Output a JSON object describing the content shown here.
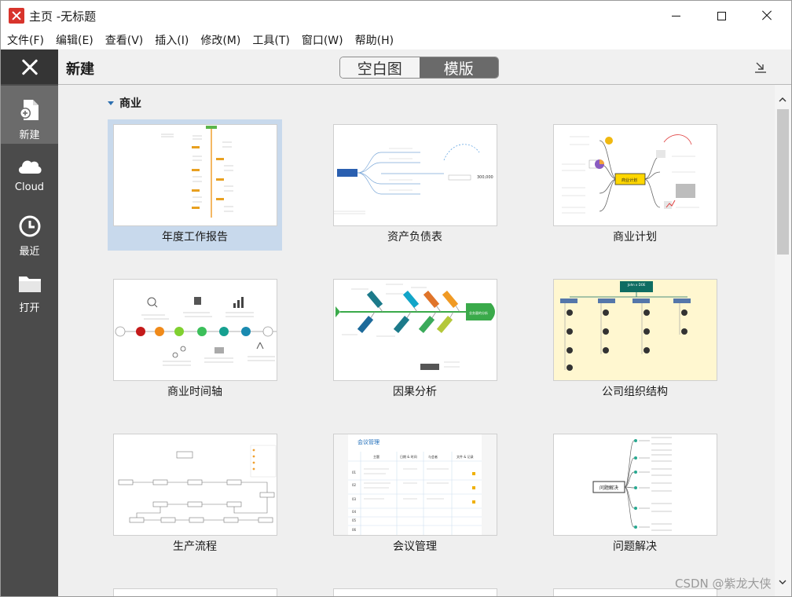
{
  "titlebar": {
    "title": "主页 -无标题"
  },
  "menubar": {
    "items": [
      "文件(F)",
      "编辑(E)",
      "查看(V)",
      "插入(I)",
      "修改(M)",
      "工具(T)",
      "窗口(W)",
      "帮助(H)"
    ]
  },
  "sidebar": {
    "items": [
      {
        "label": "新建",
        "icon": "new-file-icon"
      },
      {
        "label": "Cloud",
        "icon": "cloud-icon"
      },
      {
        "label": "最近",
        "icon": "clock-icon"
      },
      {
        "label": "打开",
        "icon": "folder-icon"
      }
    ]
  },
  "header": {
    "title": "新建",
    "tabs": [
      "空白图",
      "模版"
    ],
    "active_tab": "模版"
  },
  "category": {
    "name": "商业"
  },
  "templates": [
    {
      "label": "年度工作报告",
      "selected": true
    },
    {
      "label": "资产负债表"
    },
    {
      "label": "商业计划"
    },
    {
      "label": "商业时间轴"
    },
    {
      "label": "因果分析"
    },
    {
      "label": "公司组织结构"
    },
    {
      "label": "生产流程"
    },
    {
      "label": "会议管理"
    },
    {
      "label": "问题解决"
    }
  ],
  "thumbnail_text": {
    "plan_center": "商业计划",
    "meeting_title": "会议管理",
    "meeting_cols": [
      "主题",
      "日期 & 时间",
      "与会者",
      "文件 & 记录"
    ],
    "meeting_rows": [
      "01",
      "02",
      "03",
      "04",
      "05",
      "06"
    ],
    "problem_center": "问题解决",
    "asset_center": "资产负债表",
    "asset_value": "300,000",
    "fishbone_head": "业务量的分析",
    "timeline_nodes": [
      "有趣概念",
      "正在进行的工作 [2]",
      "正在进行的工作 [4]",
      "正在进行的工作 [1]",
      "正在进行的工作 [3]",
      "正在进行的工作 [5]"
    ],
    "org_top": "John x DOE",
    "org_depts": [
      "产品部",
      "营销部",
      "研发部",
      "人力资源部"
    ]
  },
  "colors": {
    "accent": "#d8342c",
    "sidebar_bg": "#4b4b4b",
    "selected_card": "#c8d9ec",
    "org_bg": "#fff7d0",
    "org_head": "#0f6d62"
  },
  "watermark": "CSDN @紫龙大侠"
}
